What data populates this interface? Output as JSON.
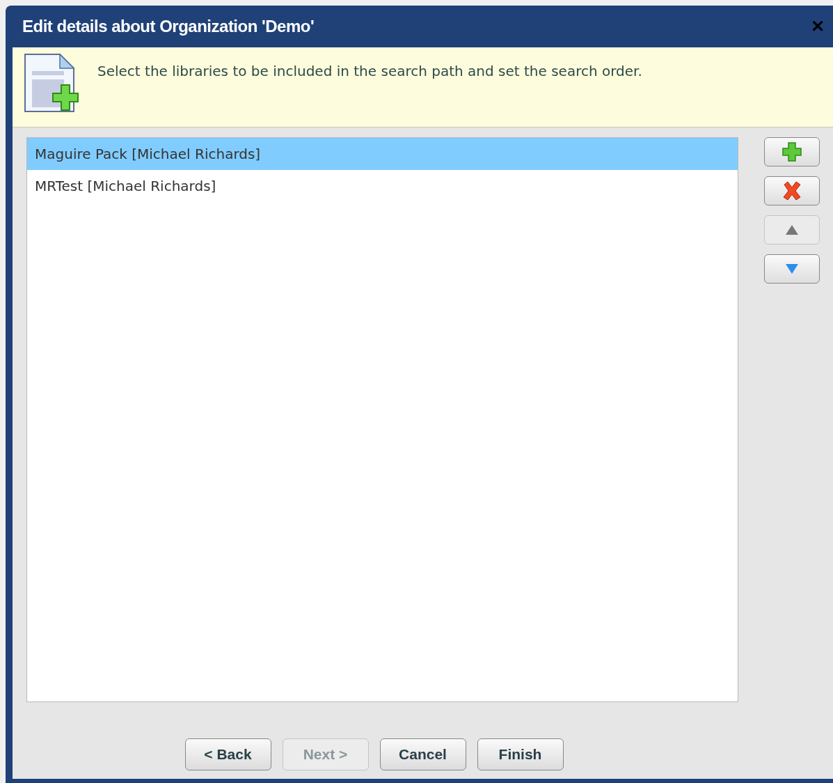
{
  "window": {
    "title": "Edit details about Organization 'Demo'",
    "close": "✕"
  },
  "info": {
    "message": "Select the libraries to be included in the search path and set the search order."
  },
  "libraries": [
    {
      "label": "Maguire Pack [Michael Richards]",
      "selected": true
    },
    {
      "label": "MRTest [Michael Richards]",
      "selected": false
    }
  ],
  "side_buttons": [
    {
      "kind": "add",
      "disabled": false
    },
    {
      "kind": "remove",
      "disabled": false
    },
    {
      "kind": "up",
      "disabled": true
    },
    {
      "kind": "down",
      "disabled": false
    }
  ],
  "buttons": [
    {
      "label": "< Back",
      "disabled": false
    },
    {
      "label": "Next >",
      "disabled": true
    },
    {
      "label": "Cancel",
      "disabled": false
    },
    {
      "label": "Finish",
      "disabled": false
    }
  ]
}
